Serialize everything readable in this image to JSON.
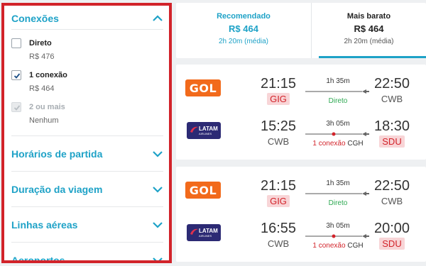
{
  "filters": {
    "connections": {
      "title": "Conexões",
      "options": [
        {
          "label": "Direto",
          "price": "R$ 476",
          "checked": false,
          "disabled": false
        },
        {
          "label": "1 conexão",
          "price": "R$ 464",
          "checked": true,
          "disabled": false
        },
        {
          "label": "2 ou mais",
          "price": "Nenhum",
          "checked": true,
          "disabled": true
        }
      ]
    },
    "sections": [
      {
        "title": "Horários de partida"
      },
      {
        "title": "Duração da viagem"
      },
      {
        "title": "Linhas aéreas"
      },
      {
        "title": "Aeroportos"
      }
    ]
  },
  "sort_tabs": [
    {
      "name": "Recomendado",
      "price": "R$ 464",
      "duration": "2h 20m (média)",
      "active": false
    },
    {
      "name": "Mais barato",
      "price": "R$ 464",
      "duration": "2h 20m (média)",
      "active": true
    }
  ],
  "flights": [
    {
      "outbound": {
        "airline": "GOL",
        "airline_logo_text": "GOL",
        "dep_time": "21:15",
        "dep_code": "GIG",
        "arr_time": "22:50",
        "arr_code": "CWB",
        "duration": "1h 35m",
        "stops": "Direto",
        "via": ""
      },
      "inbound": {
        "airline": "LATAM",
        "airline_logo_text": "LATAM",
        "airline_logo_subtext": "AIRLINES",
        "dep_time": "15:25",
        "dep_code": "CWB",
        "arr_time": "18:30",
        "arr_code": "SDU",
        "duration": "3h 05m",
        "stops": "1 conexão",
        "via": "CGH"
      }
    },
    {
      "outbound": {
        "airline": "GOL",
        "airline_logo_text": "GOL",
        "dep_time": "21:15",
        "dep_code": "GIG",
        "arr_time": "22:50",
        "arr_code": "CWB",
        "duration": "1h 35m",
        "stops": "Direto",
        "via": ""
      },
      "inbound": {
        "airline": "LATAM",
        "airline_logo_text": "LATAM",
        "airline_logo_subtext": "AIRLINES",
        "dep_time": "16:55",
        "dep_code": "CWB",
        "arr_time": "20:00",
        "arr_code": "SDU",
        "duration": "3h 05m",
        "stops": "1 conexão",
        "via": "CGH"
      }
    }
  ],
  "colors": {
    "accent": "#1ea2c7",
    "highlight_border": "#d2232a",
    "direct": "#2da851",
    "connection": "#d2232a",
    "airport_highlight_bg": "#f8d5d7",
    "gol": "#f26a1b",
    "latam": "#2c2a74"
  },
  "icons": {
    "section_expanded": "chevron-up-icon",
    "section_collapsed": "chevron-down-icon",
    "check": "check-icon",
    "route_end": "airplane-icon"
  }
}
